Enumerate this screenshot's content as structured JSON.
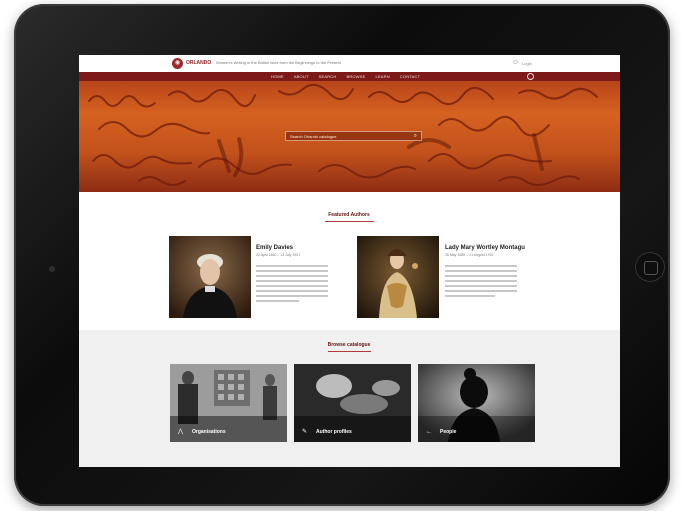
{
  "topbar": {
    "brand": "ORLANDO",
    "tagline": "Women's Writing in the British Isles from the Beginnings to the Present",
    "user_label": "Login"
  },
  "nav": {
    "items": [
      "HOME",
      "ABOUT",
      "SEARCH",
      "BROWSE",
      "LEARN",
      "CONTACT"
    ]
  },
  "hero": {
    "search_placeholder": "Search Orlando catalogue"
  },
  "featured": {
    "title": "Featured Authors",
    "authors": [
      {
        "name": "Emily Davies",
        "dates": "22 April 1830 – 13 July 1921"
      },
      {
        "name": "Lady Mary Wortley Montagu",
        "dates": "26 May 1689 – 21 August 1762"
      }
    ]
  },
  "browse": {
    "title": "Browse catalogue",
    "tiles": [
      {
        "label": "Organisations",
        "icon": "organisation-icon"
      },
      {
        "label": "Author profiles",
        "icon": "pen-icon"
      },
      {
        "label": "People",
        "icon": "arrow-icon"
      }
    ]
  },
  "colors": {
    "accent": "#7c1a1a",
    "hero": "#c2511b",
    "brand": "#8a1f1f"
  }
}
